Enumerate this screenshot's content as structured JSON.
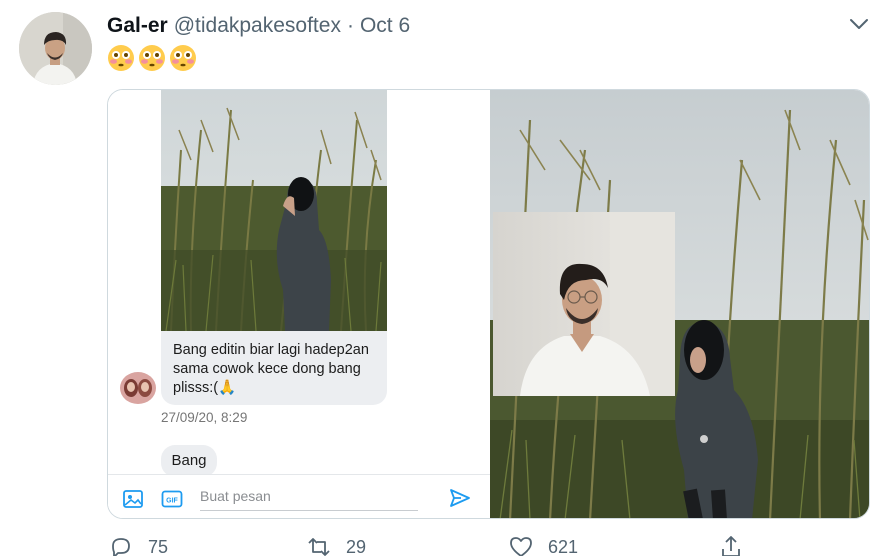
{
  "tweet": {
    "author_name": "Gal-er",
    "author_handle": "@tidakpakesoftex",
    "separator": "·",
    "date": "Oct 6",
    "emoji_text": "😳😳😳"
  },
  "media": {
    "chat": {
      "message_text": "Bang editin biar lagi hadep2an sama cowok kece dong bang plisss:(🙏",
      "timestamp": "27/09/20, 8:29",
      "followup_text": "Bang",
      "composer_placeholder": "Buat pesan"
    }
  },
  "actions": {
    "reply_count": "75",
    "retweet_count": "29",
    "like_count": "621"
  },
  "icons": [
    "chevron-down-icon",
    "image-icon",
    "gif-icon",
    "send-icon",
    "reply-icon",
    "retweet-icon",
    "like-icon",
    "share-icon"
  ],
  "colors": {
    "accent": "#1d9bf0",
    "muted": "#536471",
    "bubble": "#eceef1"
  }
}
